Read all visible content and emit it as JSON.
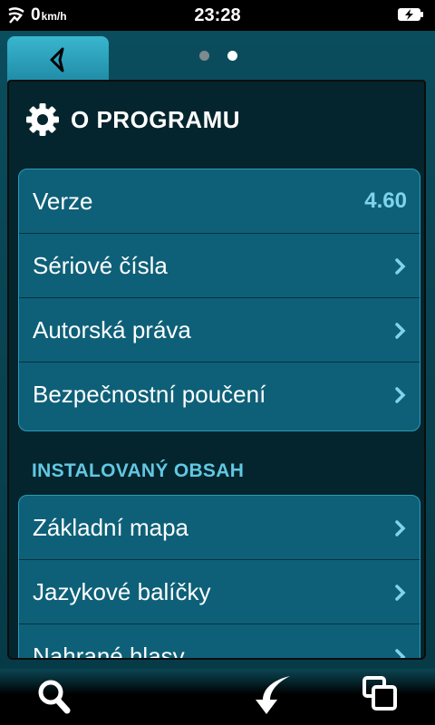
{
  "status_bar": {
    "speed": "0",
    "speed_unit": "km/h",
    "time": "23:28",
    "icons": [
      "gps-signal-icon",
      "battery-charging-icon"
    ]
  },
  "nav": {
    "back_icon": "back-arrow-icon",
    "pages": 2,
    "active_page": 2
  },
  "section": {
    "icon": "gear-icon",
    "title": "O PROGRAMU",
    "rows": [
      {
        "label": "Verze",
        "value": "4.60"
      },
      {
        "label": "Sériové čísla",
        "icon": "chevron-right-icon"
      },
      {
        "label": "Autorská práva",
        "icon": "chevron-right-icon"
      },
      {
        "label": "Bezpečnostní poučení",
        "icon": "chevron-right-icon"
      }
    ]
  },
  "installed": {
    "title": "INSTALOVANÝ OBSAH",
    "rows": [
      {
        "label": "Základní mapa",
        "icon": "chevron-right-icon"
      },
      {
        "label": "Jazykové balíčky",
        "icon": "chevron-right-icon"
      },
      {
        "label": "Nahrané hlasy",
        "icon": "chevron-right-icon"
      }
    ]
  },
  "bottom_bar": {
    "icons": [
      "search-icon",
      "confirm-arrow-icon",
      "windows-icon"
    ]
  },
  "colors": {
    "accent": "#62c7e2",
    "row_bg": "#0e6078",
    "panel_bg": "#04252d",
    "tab": "#2aa3bf"
  }
}
